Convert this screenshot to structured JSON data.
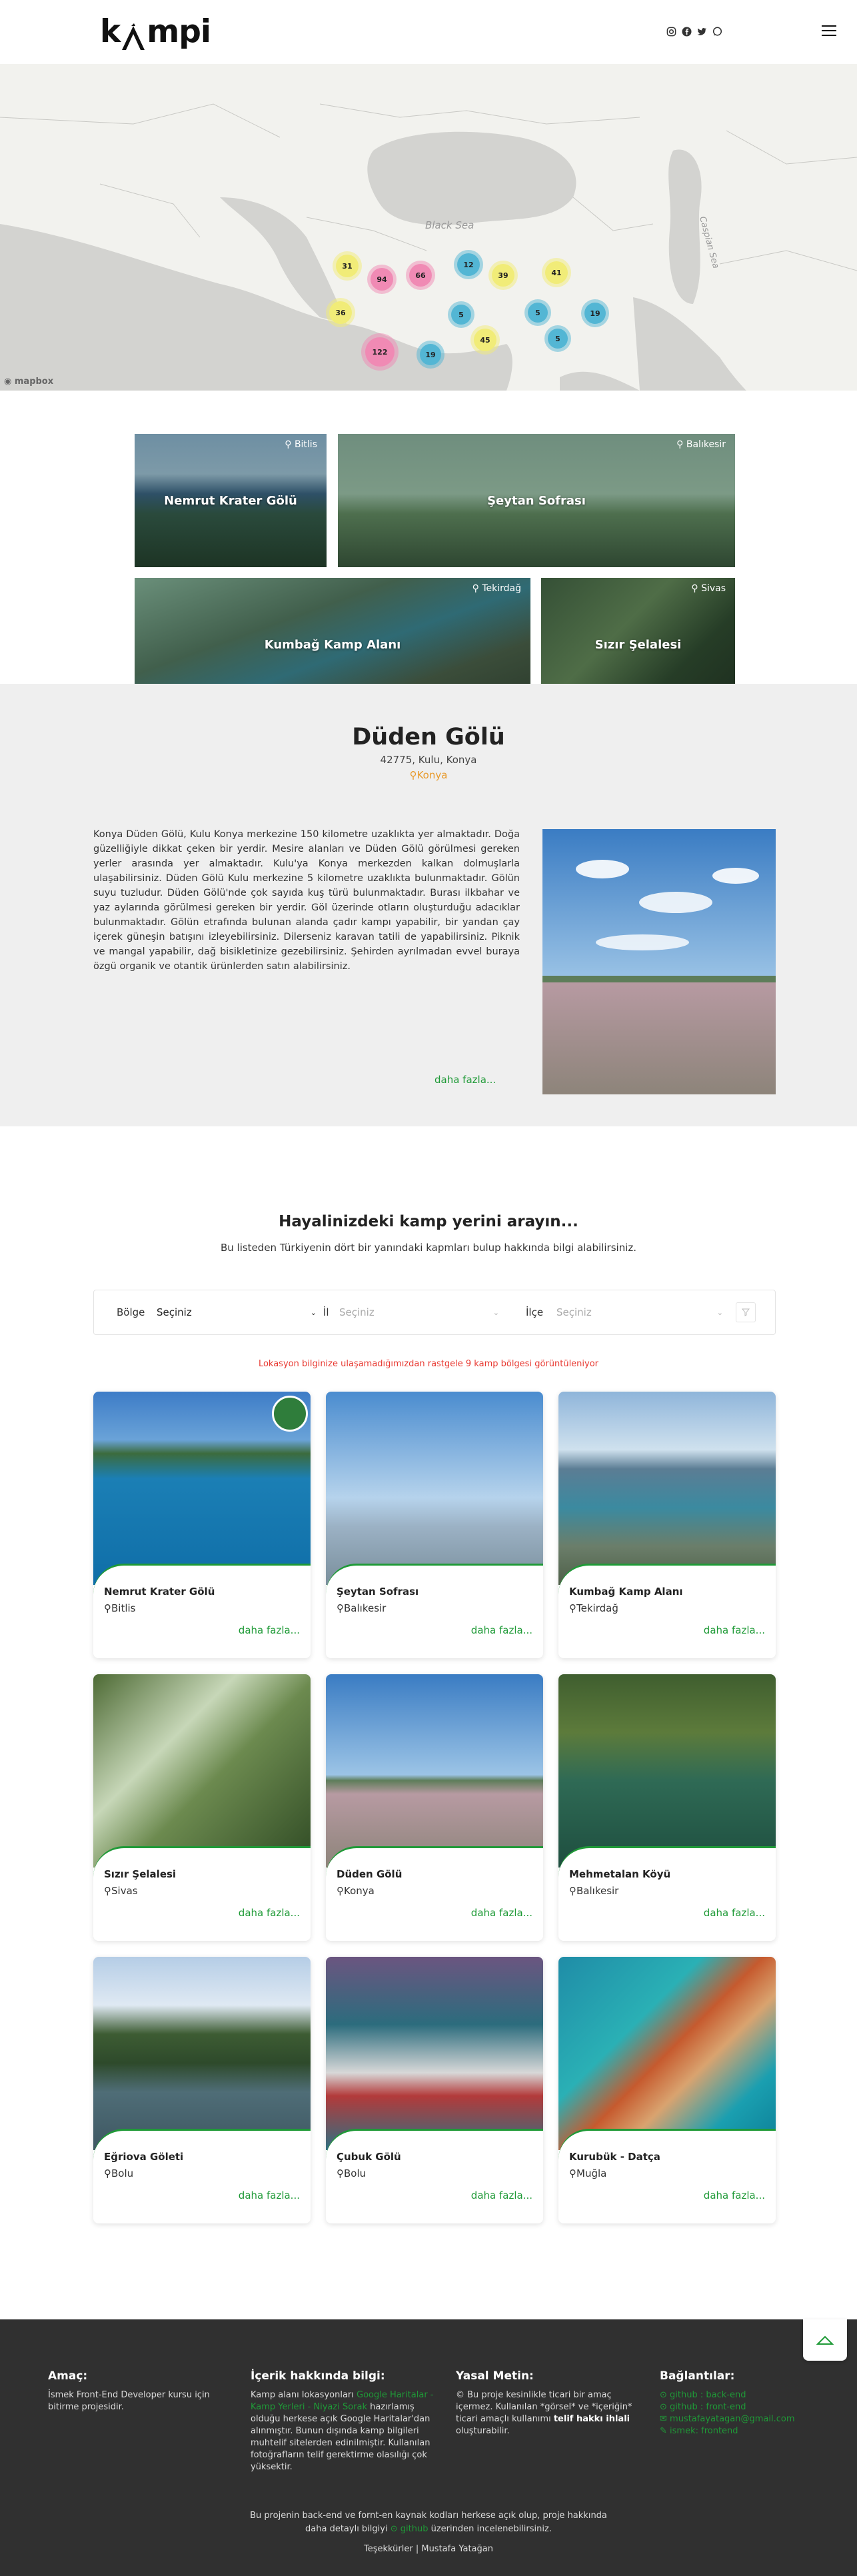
{
  "brand": {
    "logo_prefix": "k",
    "logo_suffix": "mpi",
    "accent": "#1f9a37",
    "pin_color": "#e89a2b"
  },
  "header": {
    "socials": [
      "instagram-icon",
      "facebook-icon",
      "twitter-icon",
      "whatsapp-icon"
    ]
  },
  "map": {
    "sea_labels": {
      "black_sea": "Black Sea",
      "caspian": "Caspian Sea"
    },
    "attribution": "mapbox",
    "clusters": [
      "31",
      "94",
      "66",
      "12",
      "39",
      "41",
      "36",
      "5",
      "5",
      "19",
      "5",
      "45",
      "122",
      "19"
    ]
  },
  "featured": [
    {
      "name": "Nemrut Krater Gölü",
      "location": "Bitlis"
    },
    {
      "name": "Şeytan Sofrası",
      "location": "Balıkesir"
    },
    {
      "name": "Kumbağ Kamp Alanı",
      "location": "Tekirdağ"
    },
    {
      "name": "Sızır Şelalesi",
      "location": "Sivas"
    }
  ],
  "detail": {
    "title": "Düden Gölü",
    "address": "42775, Kulu, Konya",
    "province": "Konya",
    "description": "Konya Düden Gölü, Kulu Konya merkezine 150 kilometre uzaklıkta yer almaktadır. Doğa güzelliğiyle dikkat çeken bir yerdir. Mesire alanları ve Düden Gölü görülmesi gereken yerler arasında yer almaktadır. Kulu'ya Konya merkezden kalkan dolmuşlarla ulaşabilirsiniz. Düden Gölü Kulu merkezine 5 kilometre uzaklıkta bulunmaktadır. Gölün suyu tuzludur. Düden Gölü'nde çok sayıda kuş türü bulunmaktadır. Burası ilkbahar ve yaz aylarında görülmesi gereken bir yerdir. Göl üzerinde otların oluşturduğu adacıklar bulunmaktadır. Gölün etrafında bulunan alanda çadır kampı yapabilir, bir yandan çay içerek güneşin batışını izleyebilirsiniz. Dilerseniz karavan tatili de yapabilirsiniz. Piknik ve mangal yapabilir, dağ bisikletinize gezebilirsiniz. Şehirden ayrılmadan evvel buraya özgü organik ve otantik ürünlerden satın alabilirsiniz.",
    "more": "daha fazla..."
  },
  "search": {
    "title": "Hayalinizdeki kamp yerini arayın...",
    "subtitle": "Bu listeden Türkiyenin dört bir yanındaki kapmları bulup hakkında bilgi alabilirsiniz.",
    "region_label": "Bölge",
    "region_value": "Seçiniz",
    "city_label": "İl",
    "city_placeholder": "Seçiniz",
    "district_label": "İlçe",
    "district_placeholder": "Seçiniz",
    "warning": "Lokasyon bilginize ulaşamadığımızdan rastgele 9 kamp bölgesi görüntüleniyor"
  },
  "places": [
    {
      "name": "Nemrut Krater Gölü",
      "province": "Bitlis",
      "more": "daha fazla..."
    },
    {
      "name": "Şeytan Sofrası",
      "province": "Balıkesir",
      "more": "daha fazla..."
    },
    {
      "name": "Kumbağ Kamp Alanı",
      "province": "Tekirdağ",
      "more": "daha fazla..."
    },
    {
      "name": "Sızır Şelalesi",
      "province": "Sivas",
      "more": "daha fazla..."
    },
    {
      "name": "Düden Gölü",
      "province": "Konya",
      "more": "daha fazla..."
    },
    {
      "name": "Mehmetalan Köyü",
      "province": "Balıkesir",
      "more": "daha fazla..."
    },
    {
      "name": "Eğriova Göleti",
      "province": "Bolu",
      "more": "daha fazla..."
    },
    {
      "name": "Çubuk Gölü",
      "province": "Bolu",
      "more": "daha fazla..."
    },
    {
      "name": "Kurubük - Datça",
      "province": "Muğla",
      "more": "daha fazla..."
    }
  ],
  "footer": {
    "purpose_title": "Amaç:",
    "purpose_text": "İsmek Front-End Developer kursu için bitirme projesidir.",
    "content_title": "İçerik hakkında bilgi:",
    "content_text_1": "Kamp alanı lokasyonları",
    "content_link": "Google Haritalar - Kamp Yerleri - Niyazi Sorak",
    "content_text_2": "hazırlamış olduğu herkese açık Google Haritalar'dan alınmıştır. Bunun dışında kamp bilgileri muhtelif sitelerden edinilmiştir. Kullanılan fotoğrafların telif gerektirme olasılığı çok yüksektir.",
    "legal_title": "Yasal Metin:",
    "legal_text_1": "© Bu proje kesinlikle ticari bir amaç içermez. Kullanılan *görsel* ve *içeriğin* ticari amaçlı kullanımı",
    "legal_bold": "telif hakkı ihlali",
    "legal_text_2": "oluşturabilir.",
    "links_title": "Bağlantılar:",
    "links": [
      "github : back-end",
      "github : front-end",
      "mustafayatagan@gmail.com",
      "ismek: frontend"
    ],
    "bottom_1": "Bu projenin back-end ve fornt-en kaynak kodları herkese açık olup, proje hakkında",
    "bottom_2": "daha detaylı bilgiyi",
    "bottom_link": "github",
    "bottom_3": "üzerinden incelenebilirsiniz.",
    "credits": "Teşekkürler | Mustafa Yatağan"
  }
}
